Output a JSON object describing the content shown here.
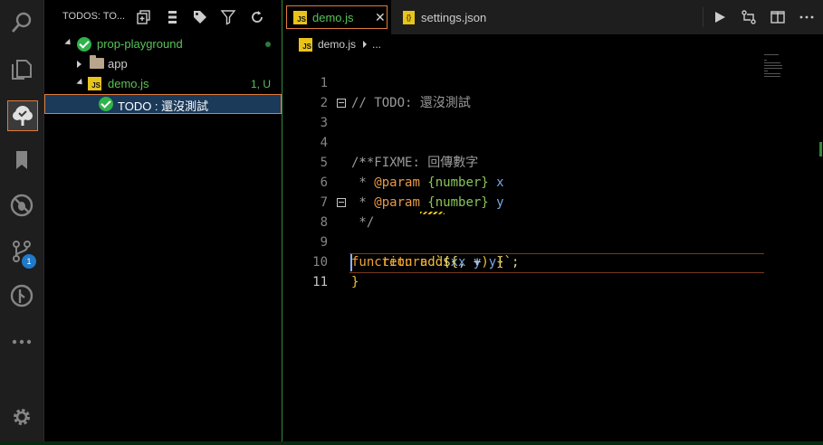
{
  "sidebar": {
    "title": "TODOS: TO...",
    "tree": {
      "workspace": {
        "label": "prop-playground"
      },
      "app": {
        "label": "app"
      },
      "file": {
        "label": "demo.js",
        "badge": "1, U"
      },
      "todo": {
        "label": "TODO : 還沒測試"
      }
    }
  },
  "activity": {
    "scm_badge": "1"
  },
  "editor": {
    "tabs": [
      {
        "label": "demo.js",
        "icon": "JS"
      },
      {
        "label": "settings.json",
        "icon": "{}"
      }
    ],
    "breadcrumb": {
      "file": "demo.js",
      "rest": "..."
    },
    "line_numbers": [
      "1",
      "2",
      "3",
      "4",
      "5",
      "6",
      "7",
      "8",
      "9",
      "10",
      "11"
    ],
    "code": {
      "l1": "// TODO: 還沒測試",
      "l3": "/**",
      "l4_star": " * ",
      "l4_text": "FIXME: 回傳數字",
      "l5_star": " * ",
      "l5_tag": "@param",
      "l5_type": " {number}",
      "l5_name": " x",
      "l6_star": " * ",
      "l6_tag": "@param",
      "l6_type": " {number}",
      "l6_name": " y",
      "l7": " */",
      "l8_kw": "function ",
      "l8_fn": "add",
      "l8_open": "(",
      "l8_x": "x",
      "l8_comma": ", ",
      "l8_y": "y",
      "l8_close": ") {",
      "l9_indent": "    ",
      "l9_kw": "return",
      "l9_sp": " ",
      "l9_tick": "`${",
      "l9_x": "x",
      "l9_plus": " + ",
      "l9_y": "y",
      "l9_end": "}`;",
      "l10": "}"
    }
  },
  "colors": {
    "accent": "#e07b3c",
    "green": "#2fb34a",
    "js_yellow": "#e8c41a"
  }
}
